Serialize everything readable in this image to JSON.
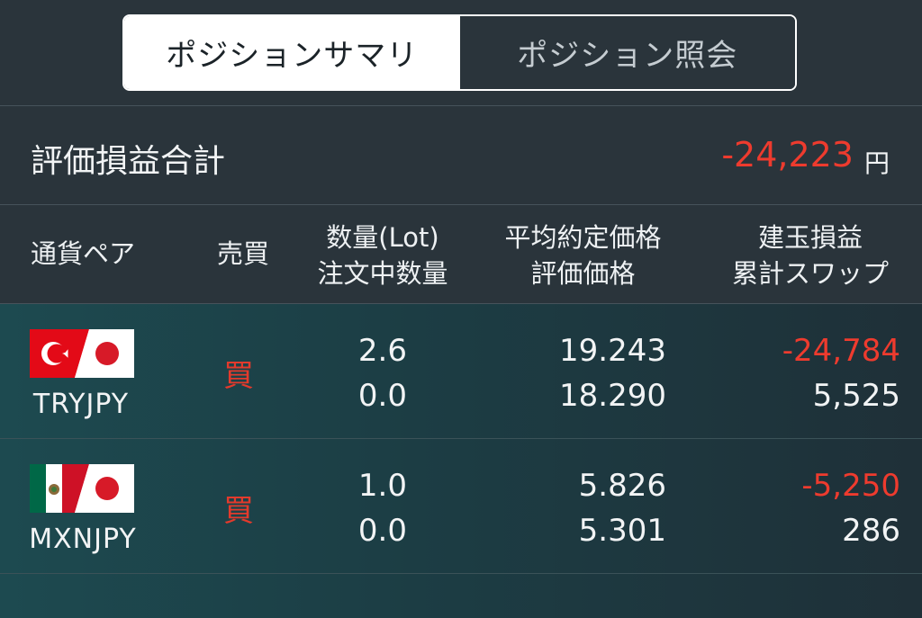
{
  "tabs": {
    "summary_label": "ポジションサマリ",
    "inquiry_label": "ポジション照会"
  },
  "total": {
    "label": "評価損益合計",
    "value": "-24,223",
    "unit": "円"
  },
  "columns": {
    "pair": "通貨ペア",
    "side": "売買",
    "lot_line1": "数量(Lot)",
    "lot_line2": "注文中数量",
    "price_line1": "平均約定価格",
    "price_line2": "評価価格",
    "pl_line1": "建玉損益",
    "pl_line2": "累計スワップ"
  },
  "rows": [
    {
      "pair": "TRYJPY",
      "flags": [
        "turkey-flag-icon",
        "japan-flag-icon"
      ],
      "side": "買",
      "lot": "2.6",
      "ordered": "0.0",
      "avg_price": "19.243",
      "eval_price": "18.290",
      "pl": "-24,784",
      "swap": "5,525"
    },
    {
      "pair": "MXNJPY",
      "flags": [
        "mexico-flag-icon",
        "japan-flag-icon"
      ],
      "side": "買",
      "lot": "1.0",
      "ordered": "0.0",
      "avg_price": "5.826",
      "eval_price": "5.301",
      "pl": "-5,250",
      "swap": "286"
    }
  ],
  "colors": {
    "background": "#2a343b",
    "negative": "#ee3b2e",
    "buy": "#e43a2c",
    "active_tab": "#ffffff"
  }
}
